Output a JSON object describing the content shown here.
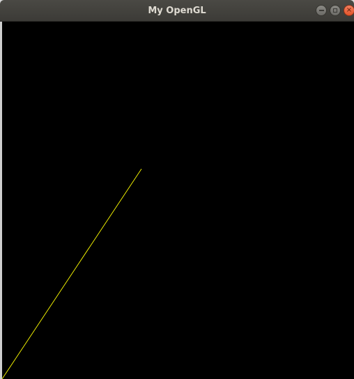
{
  "window": {
    "title": "My OpenGL"
  },
  "controls": {
    "minimize_icon": "minimize-icon",
    "maximize_icon": "maximize-icon",
    "close_icon": "close-icon",
    "close_glyph": "×"
  },
  "colors": {
    "titlebar": "#3c3b37",
    "title_text": "#dfdbd2",
    "canvas_background": "#000000",
    "line": "#ffff00",
    "close_button": "#e9592e"
  }
}
